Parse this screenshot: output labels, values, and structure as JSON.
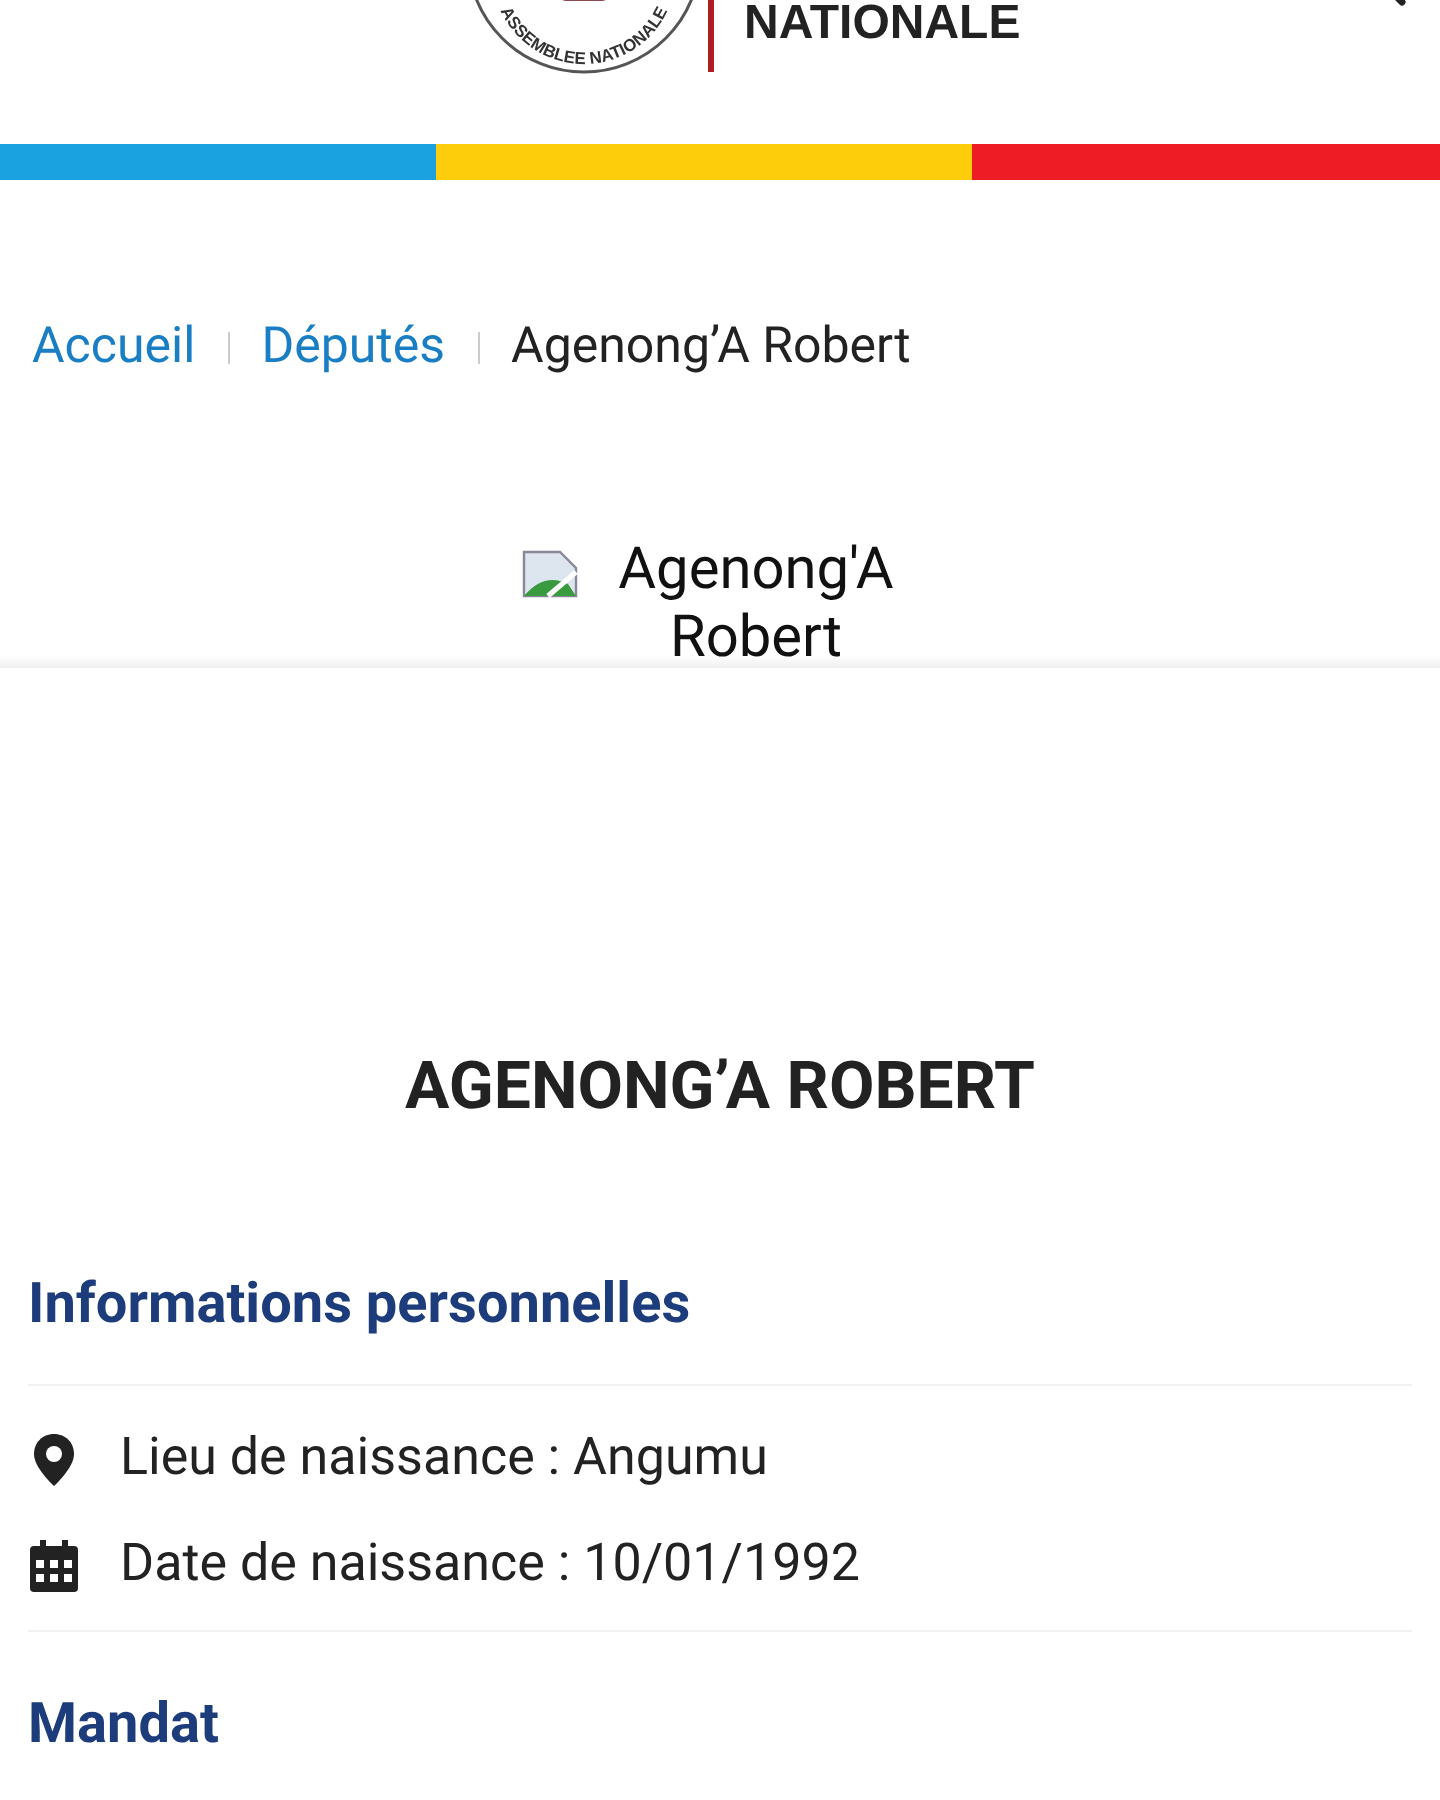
{
  "header": {
    "logo_text": "ASSEMBLEE NATIONALE",
    "title": "NATIONALE"
  },
  "breadcrumb": [
    {
      "label": "Accueil",
      "kind": "link"
    },
    {
      "label": "Députés",
      "kind": "link"
    },
    {
      "label": "Agenong’A Robert",
      "kind": "current"
    }
  ],
  "photo": {
    "alt": "Agenong'A Robert"
  },
  "name": "AGENONG’A ROBERT",
  "sections": [
    {
      "title": "Informations personnelles",
      "items": [
        {
          "kind": "place",
          "text": "Lieu de naissance : Angumu"
        },
        {
          "kind": "date",
          "text": "Date de naissance : 10/01/1992"
        }
      ]
    },
    {
      "title": "Mandat"
    }
  ]
}
